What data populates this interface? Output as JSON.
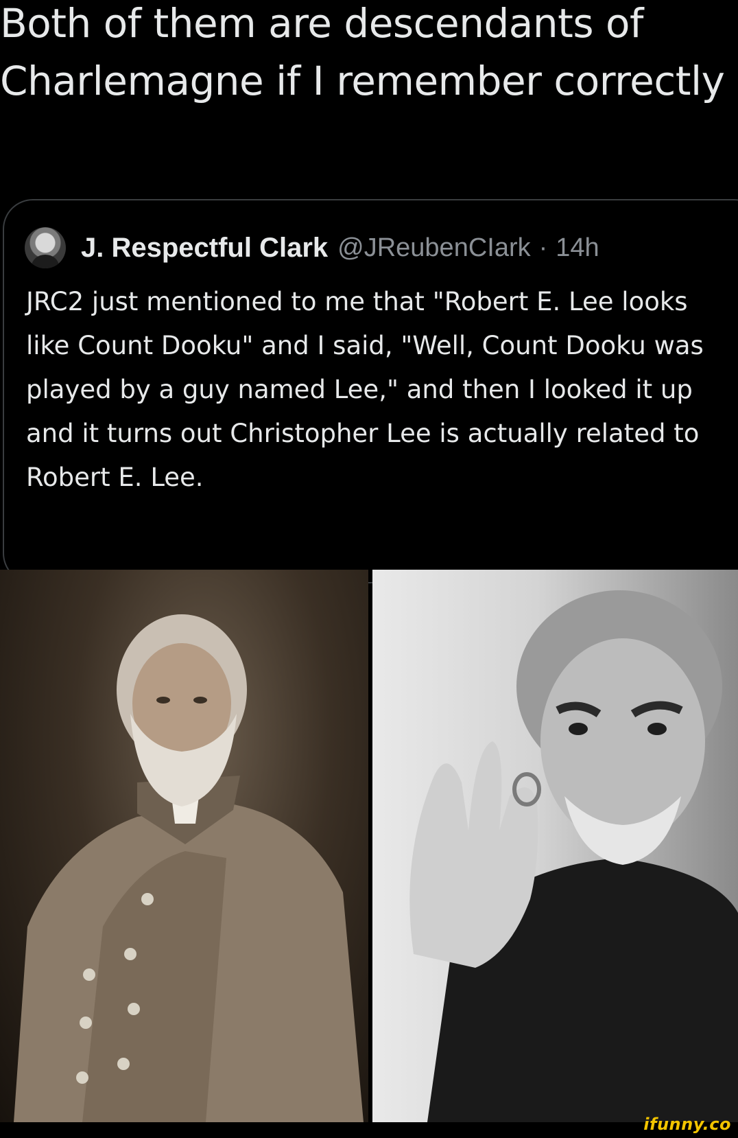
{
  "reply": {
    "text": "Both of them are descendants of Charlemagne if I remember correctly"
  },
  "quoted_tweet": {
    "display_name": "J. Respectful Clark",
    "handle": "@JReubenCIark",
    "separator": "·",
    "time": "14h",
    "body": "JRC2 just mentioned to me that \"Robert E. Lee looks like Count Dooku\" and I said, \"Well, Count Dooku was played by a guy named Lee,\" and then I looked it up and it turns out Christopher Lee is actually related to Robert E. Lee."
  },
  "watermark": {
    "text": "ifunny.co"
  }
}
